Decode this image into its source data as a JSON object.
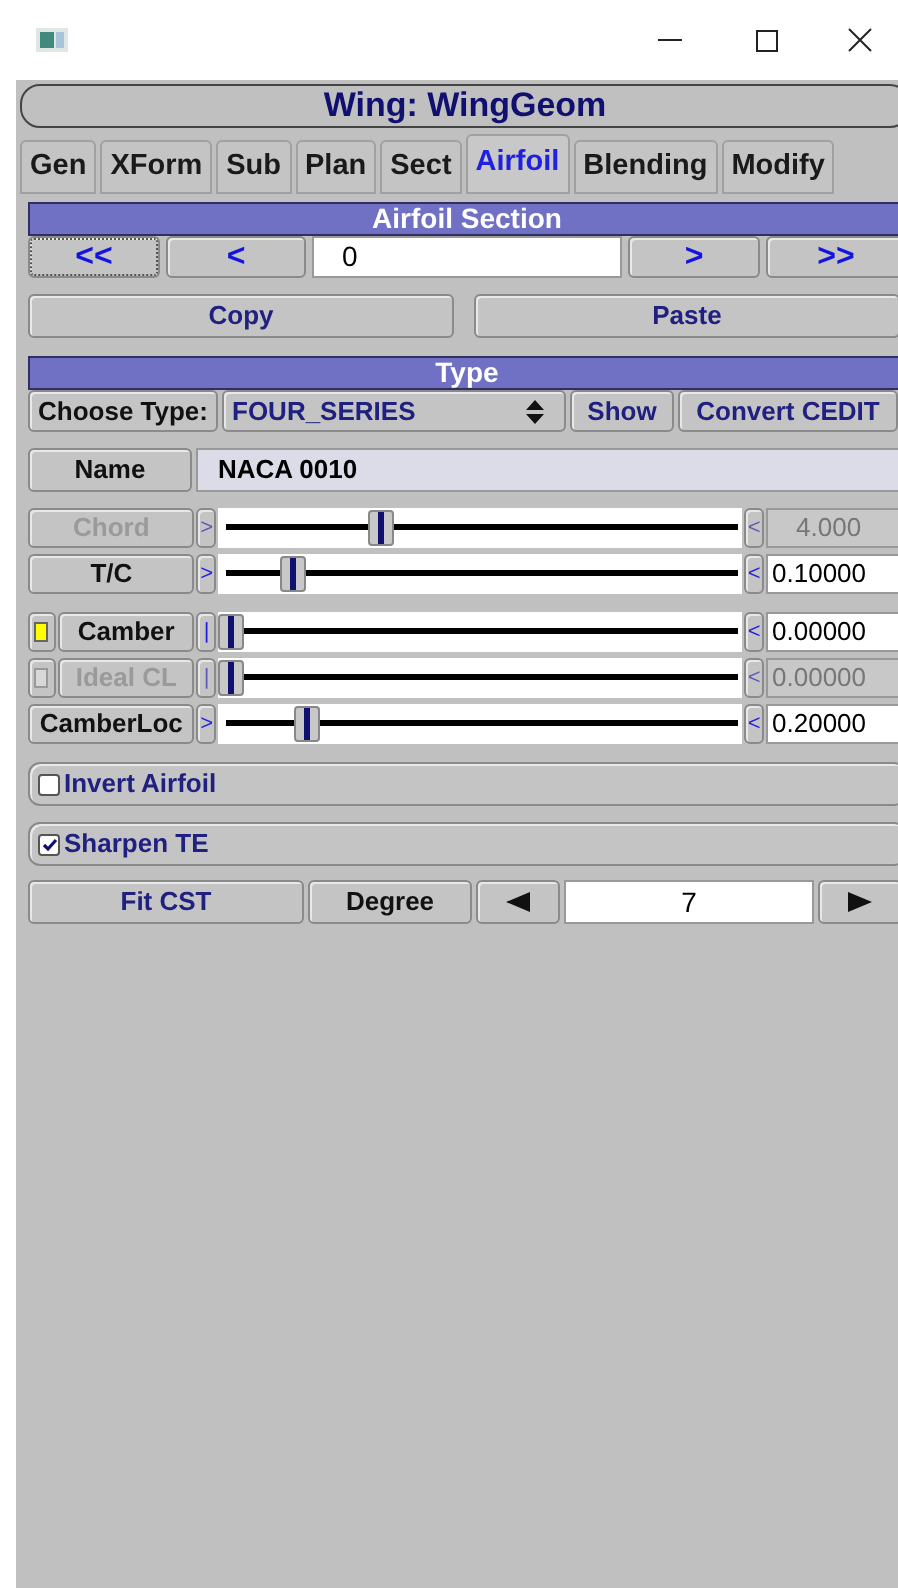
{
  "window": {
    "title": "Wing: WingGeom"
  },
  "tabs": [
    {
      "label": "Gen",
      "selected": false
    },
    {
      "label": "XForm",
      "selected": false
    },
    {
      "label": "Sub",
      "selected": false
    },
    {
      "label": "Plan",
      "selected": false
    },
    {
      "label": "Sect",
      "selected": false
    },
    {
      "label": "Airfoil",
      "selected": true
    },
    {
      "label": "Blending",
      "selected": false
    },
    {
      "label": "Modify",
      "selected": false
    }
  ],
  "airfoil_section": {
    "header": "Airfoil Section",
    "nav": [
      "<<",
      "<",
      ">",
      ">>"
    ],
    "index": "0",
    "copy": "Copy",
    "paste": "Paste"
  },
  "type_section": {
    "header": "Type",
    "choose_label": "Choose Type:",
    "choice": "FOUR_SERIES",
    "show": "Show",
    "convert": "Convert CEDIT",
    "name_label": "Name",
    "name_value": "NACA 0010"
  },
  "sliders": [
    {
      "label": "Chord",
      "kind": "plain",
      "disabled": true,
      "left_marker": ">",
      "right_marker": "<",
      "level": 0.3,
      "value": "4.000"
    },
    {
      "label": "T/C",
      "kind": "plain",
      "disabled": false,
      "left_marker": ">",
      "right_marker": "<",
      "level": 0.125,
      "value": "0.10000"
    },
    {
      "label": "Camber",
      "kind": "toggle",
      "checked": true,
      "disabled": false,
      "left_marker": "|",
      "right_marker": "<",
      "level": 0,
      "value": "0.00000"
    },
    {
      "label": "Ideal CL",
      "kind": "toggle",
      "checked": false,
      "disabled": true,
      "left_marker": "|",
      "right_marker": "<",
      "level": 0,
      "value": "0.00000"
    },
    {
      "label": "CamberLoc",
      "kind": "plain",
      "disabled": false,
      "left_marker": ">",
      "right_marker": "<",
      "level": 0.15,
      "value": "0.20000"
    }
  ],
  "options": [
    {
      "label": "Invert Airfoil",
      "checked": false
    },
    {
      "label": "Sharpen TE",
      "checked": true
    }
  ],
  "cst": {
    "fit": "Fit CST",
    "degree_label": "Degree",
    "degree_value": "7"
  }
}
